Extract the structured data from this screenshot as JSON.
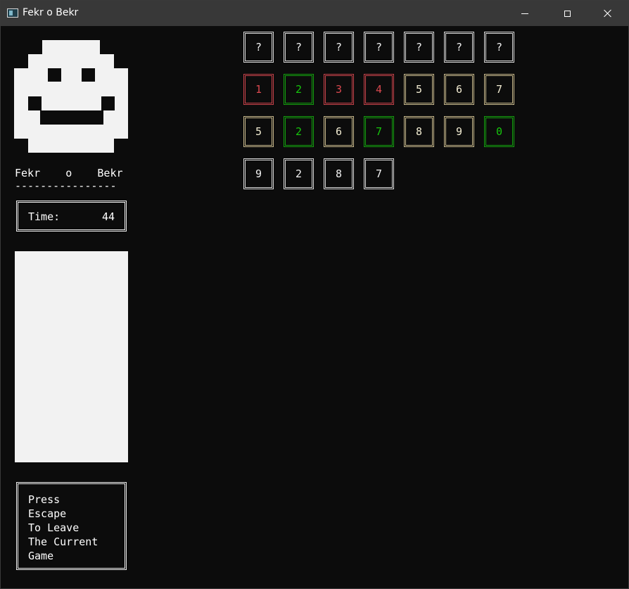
{
  "window": {
    "title": "Fekr o Bekr",
    "icons": {
      "app": "console-app-icon",
      "minimize": "minimize-icon",
      "maximize": "maximize-icon",
      "close": "close-icon"
    }
  },
  "sidebar": {
    "game_title": "Fekr    o    Bekr",
    "separator": "----------------",
    "timer": {
      "label": "Time:",
      "value": "44"
    },
    "escape_lines": [
      "Press",
      "Escape",
      "To Leave",
      "The Current",
      "Game"
    ]
  },
  "colors": {
    "red": "#d9484f",
    "green": "#16c60c",
    "yellow": "#f2ecd2",
    "white": "#f2f2f2",
    "background": "#0c0c0c"
  },
  "board": {
    "secret_row": [
      "?",
      "?",
      "?",
      "?",
      "?",
      "?",
      "?"
    ],
    "rows": [
      [
        {
          "digit": "1",
          "state": "red"
        },
        {
          "digit": "2",
          "state": "green"
        },
        {
          "digit": "3",
          "state": "red"
        },
        {
          "digit": "4",
          "state": "red"
        },
        {
          "digit": "5",
          "state": "yellow"
        },
        {
          "digit": "6",
          "state": "yellow"
        },
        {
          "digit": "7",
          "state": "yellow"
        }
      ],
      [
        {
          "digit": "5",
          "state": "yellow"
        },
        {
          "digit": "2",
          "state": "green"
        },
        {
          "digit": "6",
          "state": "yellow"
        },
        {
          "digit": "7",
          "state": "green"
        },
        {
          "digit": "8",
          "state": "yellow"
        },
        {
          "digit": "9",
          "state": "yellow"
        },
        {
          "digit": "0",
          "state": "green"
        }
      ],
      [
        {
          "digit": "9",
          "state": "white"
        },
        {
          "digit": "2",
          "state": "white"
        },
        {
          "digit": "8",
          "state": "white"
        },
        {
          "digit": "7",
          "state": "white"
        }
      ]
    ]
  }
}
